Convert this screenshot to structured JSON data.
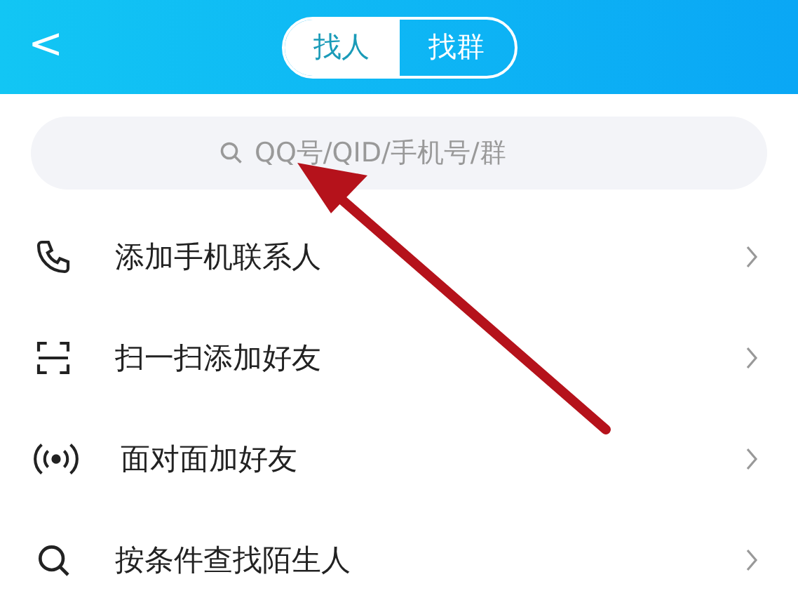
{
  "header": {
    "back": "<",
    "tabs": [
      {
        "label": "找人",
        "selected": true
      },
      {
        "label": "找群",
        "selected": false
      }
    ]
  },
  "search": {
    "placeholder": "QQ号/QID/手机号/群"
  },
  "items": [
    {
      "kind": "phone",
      "label": "添加手机联系人"
    },
    {
      "kind": "scan",
      "label": "扫一扫添加好友"
    },
    {
      "kind": "nearby",
      "label": "面对面加好友"
    },
    {
      "kind": "search",
      "label": "按条件查找陌生人"
    }
  ]
}
